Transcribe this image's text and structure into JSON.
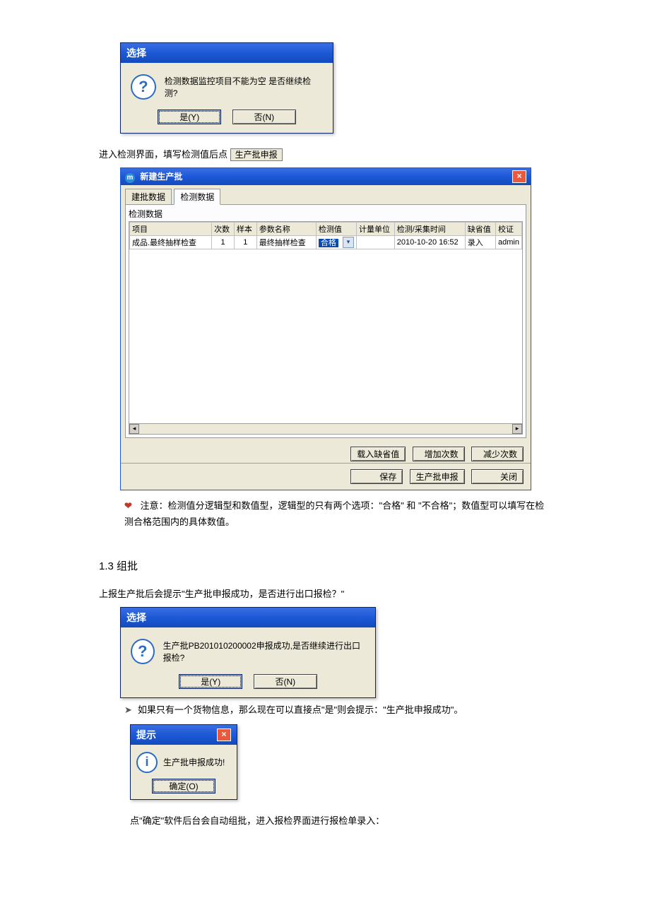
{
  "dialog1": {
    "title": "选择",
    "message": "检测数据监控项目不能为空 是否继续检测?",
    "yes": "是(Y)",
    "no": "否(N)"
  },
  "line1_prefix": "进入检测界面，填写检测值后点",
  "line1_button": "生产批申报",
  "big_window": {
    "title": "新建生产批",
    "tabs": [
      "建批数据",
      "检测数据"
    ],
    "group": "检测数据",
    "columns": [
      "项目",
      "次数",
      "样本",
      "参数名称",
      "检测值",
      "计量单位",
      "检测/采集时间",
      "缺省值",
      "校证"
    ],
    "row": {
      "project": "成品.最终抽样检查",
      "count": "1",
      "sample": "1",
      "param": "最终抽样检查",
      "value": "合格",
      "unit": "",
      "time": "2010-10-20 16:52",
      "default": "录入",
      "verify": "admin"
    },
    "buttons_top": [
      "载入缺省值",
      "增加次数",
      "减少次数"
    ],
    "buttons_bottom": [
      "保存",
      "生产批申报",
      "关闭"
    ]
  },
  "note1": "注意：检测值分逻辑型和数值型，逻辑型的只有两个选项：\"合格\" 和 \"不合格\"；数值型可以填写在检测合格范围内的具体数值。",
  "heading": "1.3 组批",
  "line2": "上报生产批后会提示\"生产批申报成功，是否进行出口报检？\"",
  "dialog2": {
    "title": "选择",
    "message": "生产批PB201010200002申报成功,是否继续进行出口报检?",
    "yes": "是(Y)",
    "no": "否(N)"
  },
  "bullet1": "如果只有一个货物信息，那么现在可以直接点\"是\"则会提示：\"生产批申报成功\"。",
  "dialog3": {
    "title": "提示",
    "message": "生产批申报成功!",
    "ok": "确定(O)"
  },
  "line3": "点\"确定\"软件后台会自动组批，进入报检界面进行报检单录入："
}
